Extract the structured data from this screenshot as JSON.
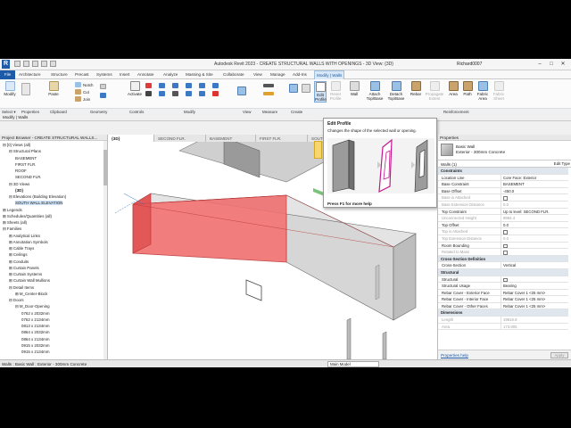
{
  "window": {
    "logo": "R",
    "title": "Autodesk Revit 2023 - CREATE STRUCTURAL WALLS WITH OPENINGS - 3D View: {3D}",
    "user": "Richard0007",
    "minimize": "–",
    "restore": "□",
    "close": "✕"
  },
  "tabs": [
    "File",
    "Architecture",
    "Structure",
    "Precast",
    "Systems",
    "Insert",
    "Annotate",
    "Analyze",
    "Massing & Site",
    "Collaborate",
    "View",
    "Manage",
    "Add-Ins",
    "Modify | Walls"
  ],
  "ribbon": {
    "modify": "Modify",
    "paste": "Paste",
    "notch": "Notch",
    "cut": "Cut",
    "join": "Join",
    "activate": "Activate",
    "edit_profile": "Edit\nProfile",
    "reset_profile": "Reset\nProfile",
    "wall": "Wall",
    "attach": "Attach\nTop/Base",
    "detach": "Detach\nTop/Base",
    "rebar": "Rebar",
    "propagate": "Propagate\nExtent",
    "area": "Area",
    "path": "Path",
    "fabric_area": "Fabric\nArea",
    "fabric_sheet": "Fabric\nSheet"
  },
  "panels": [
    "Select ▾",
    "Properties",
    "Clipboard",
    "Geometry",
    "Controls",
    "Modify",
    "View",
    "Measure",
    "Create",
    "Reinforcement"
  ],
  "options_bar": "Modify | Walls",
  "project_browser": {
    "header": "Project Browser - CREATE STRUCTURAL WALLS...",
    "items": [
      {
        "label": "⊟ [0] Views (all)",
        "indent": 0
      },
      {
        "label": "⊟ Structural Plans",
        "indent": 1
      },
      {
        "label": "BASEMENT",
        "indent": 2
      },
      {
        "label": "FIRST FLR.",
        "indent": 2
      },
      {
        "label": "ROOF",
        "indent": 2
      },
      {
        "label": "SECOND FLR.",
        "indent": 2
      },
      {
        "label": "⊟ 3D Views",
        "indent": 1
      },
      {
        "label": "{3D}",
        "indent": 2,
        "selected": true
      },
      {
        "label": "⊟ Elevations (Building Elevation)",
        "indent": 1
      },
      {
        "label": "SOUTH WALL ELEVATION",
        "indent": 2,
        "highlight": true
      },
      {
        "label": "⊞ Legends",
        "indent": 0
      },
      {
        "label": "⊞ Schedules/Quantities (all)",
        "indent": 0
      },
      {
        "label": "⊞ Sheets (all)",
        "indent": 0
      },
      {
        "label": "⊟ Families",
        "indent": 0
      },
      {
        "label": "⊞ Analytical Links",
        "indent": 1
      },
      {
        "label": "⊞ Annotation Symbols",
        "indent": 1
      },
      {
        "label": "⊞ Cable Trays",
        "indent": 1
      },
      {
        "label": "⊞ Ceilings",
        "indent": 1
      },
      {
        "label": "⊞ Conduits",
        "indent": 1
      },
      {
        "label": "⊞ Curtain Panels",
        "indent": 1
      },
      {
        "label": "⊞ Curtain Systems",
        "indent": 1
      },
      {
        "label": "⊞ Curtain Wall Mullions",
        "indent": 1
      },
      {
        "label": "⊟ Detail Items",
        "indent": 1
      },
      {
        "label": "⊞ M_Center-Block",
        "indent": 2
      },
      {
        "label": "⊟ Doors",
        "indent": 1
      },
      {
        "label": "⊟ M_Door-Opening",
        "indent": 2
      },
      {
        "label": "0762 x 2032mm",
        "indent": 3
      },
      {
        "label": "0762 x 2134mm",
        "indent": 3
      },
      {
        "label": "0813 x 2134mm",
        "indent": 3
      },
      {
        "label": "0864 x 2032mm",
        "indent": 3
      },
      {
        "label": "0864 x 2134mm",
        "indent": 3
      },
      {
        "label": "0915 x 2032mm",
        "indent": 3
      },
      {
        "label": "0915 x 2134mm",
        "indent": 3
      }
    ]
  },
  "view_tabs": [
    "{3D}",
    "SECOND FLR.",
    "BASEMENT",
    "FIRST FLR.",
    "SOUTH"
  ],
  "tooltip": {
    "title": "Edit Profile",
    "description": "Changes the shape of the selected wall or opening.",
    "footer": "Press F1 for more help"
  },
  "properties": {
    "header": "Properties",
    "type_line1": "Basic Wall",
    "type_line2": "Exterior - 300mm Concrete",
    "filter": "Walls (1)",
    "edit_type": "Edit Type",
    "rows": [
      {
        "cat": "Constraints"
      },
      {
        "k": "Location Line",
        "v": "Core Face: Exterior"
      },
      {
        "k": "Base Constraint",
        "v": "BASEMENT"
      },
      {
        "k": "Base Offset",
        "v": "-450.0"
      },
      {
        "k": "Base is Attached",
        "v": "",
        "grey": true,
        "check": true
      },
      {
        "k": "Base Extension Distance",
        "v": "0.0",
        "grey": true
      },
      {
        "k": "Top Constraint",
        "v": "Up to level: SECOND FLR."
      },
      {
        "k": "Unconnected Height",
        "v": "8984.4",
        "grey": true
      },
      {
        "k": "Top Offset",
        "v": "0.0"
      },
      {
        "k": "Top is Attached",
        "v": "",
        "grey": true,
        "check": true
      },
      {
        "k": "Top Extension Distance",
        "v": "0.0",
        "grey": true
      },
      {
        "k": "Room Bounding",
        "v": "",
        "check": true
      },
      {
        "k": "Related to Mass",
        "v": "",
        "grey": true,
        "check": true
      },
      {
        "cat": "Cross-Section Definition"
      },
      {
        "k": "Cross-Section",
        "v": "Vertical"
      },
      {
        "cat": "Structural"
      },
      {
        "k": "Structural",
        "v": "",
        "check": true
      },
      {
        "k": "Structural Usage",
        "v": "Bearing"
      },
      {
        "k": "Rebar Cover - Exterior Face",
        "v": "Rebar Cover 1 <25 mm>"
      },
      {
        "k": "Rebar Cover - Interior Face",
        "v": "Rebar Cover 1 <25 mm>"
      },
      {
        "k": "Rebar Cover - Other Faces",
        "v": "Rebar Cover 1 <25 mm>"
      },
      {
        "cat": "Dimensions"
      },
      {
        "k": "Length",
        "v": "19816.8",
        "grey": true
      },
      {
        "k": "Area",
        "v": "173.805",
        "grey": true
      }
    ],
    "help": "Properties help",
    "apply": "Apply"
  },
  "status": {
    "text": "Walls : Basic Wall : Exterior - 300mm Concrete",
    "model": "Main Model"
  },
  "colors": {
    "accent": "#1d5aa7",
    "selection": "#f07070",
    "tooltip_highlight": "#c2188f",
    "context_tab": "#8fd18f"
  }
}
